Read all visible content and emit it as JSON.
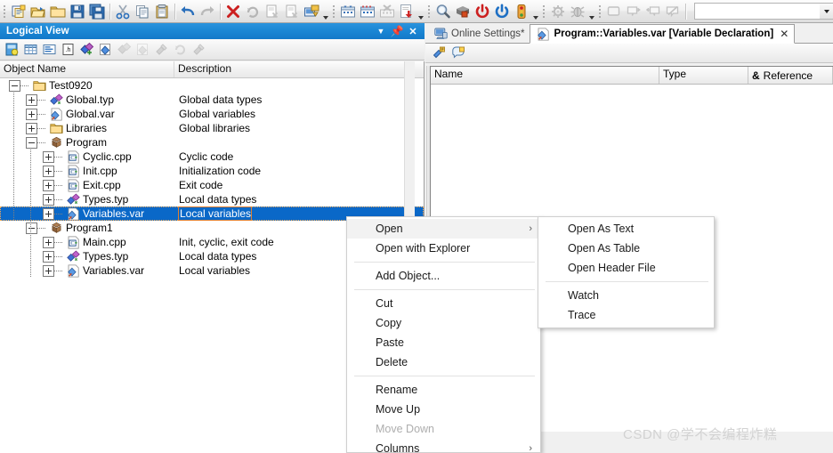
{
  "toolbar": {
    "groups": [
      {
        "name": "file",
        "buttons": [
          {
            "name": "new-object-icon",
            "label": "New Object"
          },
          {
            "name": "open-project-icon",
            "label": "Open Project"
          },
          {
            "name": "open-folder-icon",
            "label": "Open Folder"
          },
          {
            "name": "save-icon",
            "label": "Save"
          },
          {
            "name": "save-all-icon",
            "label": "Save All"
          }
        ]
      },
      {
        "name": "clipboard",
        "buttons": [
          {
            "name": "cut-icon",
            "label": "Cut"
          },
          {
            "name": "copy-icon",
            "label": "Copy"
          },
          {
            "name": "paste-icon",
            "label": "Paste"
          }
        ]
      },
      {
        "name": "history",
        "buttons": [
          {
            "name": "undo-icon",
            "label": "Undo"
          },
          {
            "name": "redo-icon",
            "label": "Redo"
          }
        ]
      },
      {
        "name": "build",
        "buttons": [
          {
            "name": "cancel-build-icon",
            "label": "Cancel Build"
          },
          {
            "name": "rebuild-icon",
            "label": "Rebuild"
          },
          {
            "name": "build-project-icon",
            "label": "Build Project"
          },
          {
            "name": "build-config-icon",
            "label": "Build Configuration"
          },
          {
            "name": "transfer-icon",
            "label": "Transfer to Target"
          }
        ]
      },
      {
        "name": "simulation",
        "buttons": [
          {
            "name": "create-sim-icon",
            "label": "Create Simulation"
          },
          {
            "name": "open-sim-icon",
            "label": "Open Simulation"
          },
          {
            "name": "remove-sim-icon",
            "label": "Remove Simulation"
          },
          {
            "name": "install-icon",
            "label": "Install"
          }
        ]
      },
      {
        "name": "online",
        "buttons": [
          {
            "name": "online-search-icon",
            "label": "Browse Target"
          },
          {
            "name": "offline-icon",
            "label": "Offline"
          },
          {
            "name": "warm-restart-icon",
            "label": "Warm Restart"
          },
          {
            "name": "cold-restart-icon",
            "label": "Cold Restart"
          },
          {
            "name": "diagnostics-icon",
            "label": "Diagnostics Manager"
          }
        ]
      },
      {
        "name": "debug",
        "buttons": [
          {
            "name": "watch-icon",
            "label": "Watch"
          },
          {
            "name": "debugger-icon",
            "label": "Debugger"
          }
        ]
      },
      {
        "name": "windows",
        "buttons": [
          {
            "name": "output-window-icon",
            "label": "Output Window"
          },
          {
            "name": "next-message-icon",
            "label": "Next Message"
          },
          {
            "name": "previous-message-icon",
            "label": "Previous Message"
          },
          {
            "name": "clear-messages-icon",
            "label": "Clear Messages"
          }
        ]
      }
    ],
    "combo_value": ""
  },
  "logical_view": {
    "title": "Logical View",
    "window_buttons": [
      {
        "name": "dropdown-menu-button",
        "glyph": "▼"
      },
      {
        "name": "auto-hide-pin-button",
        "glyph": "⏏"
      },
      {
        "name": "close-panel-button",
        "glyph": "✕"
      }
    ],
    "panel_toolbar": [
      {
        "name": "project-properties-icon",
        "label": "Properties"
      },
      {
        "name": "table-view-icon",
        "label": "Table View"
      },
      {
        "name": "text-view-icon",
        "label": "Text View"
      },
      {
        "name": "header-file-icon",
        "label": "Header File"
      },
      {
        "name": "add-data-type-icon",
        "label": "Add Data Type"
      },
      {
        "name": "add-variable-icon",
        "label": "Add Variable"
      },
      {
        "name": "insert-data-type-icon",
        "label": "Insert Data Type"
      },
      {
        "name": "insert-variable-icon",
        "label": "Insert Variable"
      },
      {
        "name": "build-object-icon",
        "label": "Build Object"
      },
      {
        "name": "rebuild-object-icon",
        "label": "Rebuild Object"
      },
      {
        "name": "transfer-object-icon",
        "label": "Transfer Object"
      }
    ],
    "columns": [
      "Object Name",
      "Description"
    ],
    "tree": [
      {
        "level": 0,
        "expander": "minus",
        "icon": "folder-icon",
        "name": "Test0920",
        "desc": ""
      },
      {
        "level": 1,
        "expander": "plus",
        "icon": "datatype-icon",
        "name": "Global.typ",
        "desc": "Global data types"
      },
      {
        "level": 1,
        "expander": "plus",
        "icon": "variable-icon",
        "name": "Global.var",
        "desc": "Global variables"
      },
      {
        "level": 1,
        "expander": "plus",
        "icon": "folder-icon",
        "name": "Libraries",
        "desc": "Global libraries"
      },
      {
        "level": 1,
        "expander": "minus",
        "icon": "program-icon",
        "name": "Program",
        "desc": ""
      },
      {
        "level": 2,
        "expander": "plus",
        "icon": "cpp-icon",
        "name": "Cyclic.cpp",
        "desc": "Cyclic code"
      },
      {
        "level": 2,
        "expander": "plus",
        "icon": "cpp-icon",
        "name": "Init.cpp",
        "desc": "Initialization code"
      },
      {
        "level": 2,
        "expander": "plus",
        "icon": "cpp-icon",
        "name": "Exit.cpp",
        "desc": "Exit code"
      },
      {
        "level": 2,
        "expander": "plus",
        "icon": "datatype-icon",
        "name": "Types.typ",
        "desc": "Local data types"
      },
      {
        "level": 2,
        "expander": "plus",
        "icon": "variable-icon",
        "name": "Variables.var",
        "desc": "Local variables",
        "selected": true
      },
      {
        "level": 1,
        "expander": "minus",
        "icon": "program-icon",
        "name": "Program1",
        "desc": ""
      },
      {
        "level": 2,
        "expander": "plus",
        "icon": "cpp-icon",
        "name": "Main.cpp",
        "desc": "Init, cyclic, exit code"
      },
      {
        "level": 2,
        "expander": "plus",
        "icon": "datatype-icon",
        "name": "Types.typ",
        "desc": "Local data types"
      },
      {
        "level": 2,
        "expander": "plus",
        "icon": "variable-icon",
        "name": "Variables.var",
        "desc": "Local variables"
      }
    ]
  },
  "editor": {
    "tabs": [
      {
        "name": "tab-online-settings",
        "label": "Online Settings*",
        "icon": "monitor-icon",
        "active": false,
        "closable": false
      },
      {
        "name": "tab-variables-var",
        "label": "Program::Variables.var [Variable Declaration]",
        "icon": "variable-icon",
        "active": true,
        "closable": true,
        "close_glyph": "✕"
      }
    ],
    "toolbar": [
      {
        "name": "add-variable-icon",
        "label": "Add Variable"
      },
      {
        "name": "edit-comment-icon",
        "label": "Edit Comment"
      }
    ],
    "grid_columns": [
      {
        "name": "column-name",
        "label": "Name"
      },
      {
        "name": "column-type",
        "label": "Type"
      },
      {
        "name": "column-reference",
        "label": "Reference",
        "prefix": "&"
      }
    ],
    "rows": []
  },
  "context_menu": {
    "items": [
      {
        "name": "menu-item-open",
        "label": "Open",
        "submenu": true,
        "arrow": "›",
        "highlighted": true,
        "enabled": true
      },
      {
        "name": "menu-item-open-with-explorer",
        "label": "Open with Explorer",
        "submenu": false,
        "enabled": true
      },
      {
        "name": "separator-1",
        "separator": true
      },
      {
        "name": "menu-item-add-object",
        "label": "Add Object...",
        "submenu": false,
        "enabled": true
      },
      {
        "name": "separator-2",
        "separator": true
      },
      {
        "name": "menu-item-cut",
        "label": "Cut",
        "submenu": false,
        "enabled": true
      },
      {
        "name": "menu-item-copy",
        "label": "Copy",
        "submenu": false,
        "enabled": true
      },
      {
        "name": "menu-item-paste",
        "label": "Paste",
        "submenu": false,
        "enabled": true
      },
      {
        "name": "menu-item-delete",
        "label": "Delete",
        "submenu": false,
        "enabled": true
      },
      {
        "name": "separator-3",
        "separator": true
      },
      {
        "name": "menu-item-rename",
        "label": "Rename",
        "submenu": false,
        "enabled": true
      },
      {
        "name": "menu-item-move-up",
        "label": "Move Up",
        "submenu": false,
        "enabled": true
      },
      {
        "name": "menu-item-move-down",
        "label": "Move Down",
        "submenu": false,
        "enabled": false
      },
      {
        "name": "menu-item-columns",
        "label": "Columns",
        "submenu": true,
        "arrow": "›",
        "enabled": true
      }
    ]
  },
  "submenu": {
    "items": [
      {
        "name": "menu-item-open-as-text",
        "label": "Open As Text",
        "enabled": true
      },
      {
        "name": "menu-item-open-as-table",
        "label": "Open As Table",
        "enabled": true
      },
      {
        "name": "menu-item-open-header-file",
        "label": "Open Header File",
        "enabled": true
      },
      {
        "name": "separator-1",
        "separator": true
      },
      {
        "name": "menu-item-watch",
        "label": "Watch",
        "enabled": true
      },
      {
        "name": "menu-item-trace",
        "label": "Trace",
        "enabled": true
      }
    ]
  },
  "watermark": {
    "text": "CSDN @学不会编程炸糕"
  },
  "colors": {
    "selection_blue": "#0a68c8",
    "title_blue": "#1a86d4",
    "focus_orange": "#e08030",
    "chrome_gray": "#f0f0f0"
  }
}
